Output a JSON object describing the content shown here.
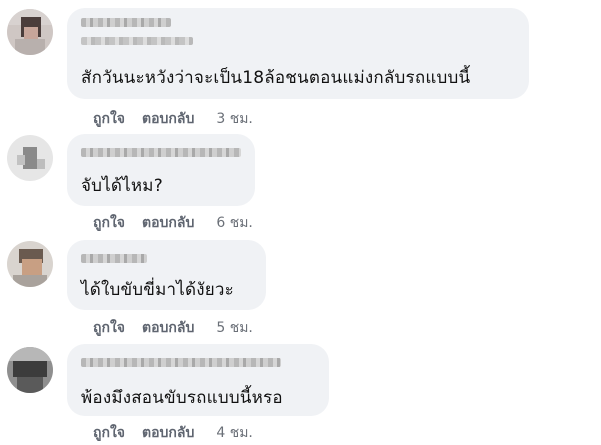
{
  "comments": [
    {
      "text": "สักวันนะหวังว่าจะเป็น18ล้อชนตอนแม่งกลับรถแบบนี้",
      "like_label": "ถูกใจ",
      "reply_label": "ตอบกลับ",
      "time": "3 ชม."
    },
    {
      "text": "จับได้ไหม?",
      "like_label": "ถูกใจ",
      "reply_label": "ตอบกลับ",
      "time": "6 ชม."
    },
    {
      "text": "ได้ใบขับขี่มาได้งัยวะ",
      "like_label": "ถูกใจ",
      "reply_label": "ตอบกลับ",
      "time": "5 ชม."
    },
    {
      "text": "พ้องมึงสอนขับรถแบบนี้หรอ",
      "like_label": "ถูกใจ",
      "reply_label": "ตอบกลับ",
      "time": "4 ชม."
    }
  ],
  "colors": {
    "bubble": "#f0f2f5",
    "text": "#111111",
    "action": "#5f6570"
  }
}
